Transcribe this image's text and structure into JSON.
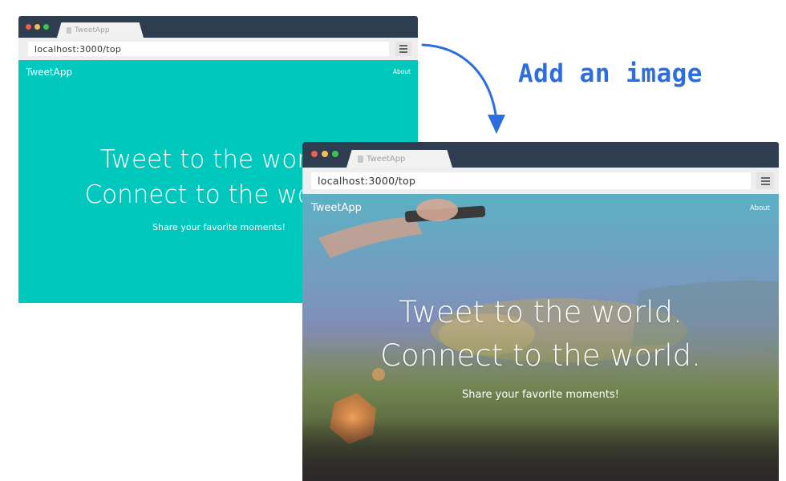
{
  "annotation": {
    "label": "Add an image",
    "color": "#2c6ee0"
  },
  "colors": {
    "titlebar": "#2f3d50",
    "teal_background": "#00c8bd",
    "traffic_red": "#f25c54",
    "traffic_yellow": "#f5bf4f",
    "traffic_green": "#3bc54d"
  },
  "before": {
    "tab_title": "TweetApp",
    "url": "localhost:3000/top",
    "tab_icon": "file-icon",
    "menu_icon": "hamburger-menu-icon",
    "nav_logo": "TweetApp",
    "nav_about": "About",
    "hero_line1": "Tweet to the world.",
    "hero_line2": "Connect to the world.",
    "sub": "Share your favorite moments!"
  },
  "after": {
    "tab_title": "TweetApp",
    "url": "localhost:3000/top",
    "tab_icon": "file-icon",
    "menu_icon": "hamburger-menu-icon",
    "nav_logo": "TweetApp",
    "nav_about": "About",
    "hero_line1": "Tweet to the world.",
    "hero_line2": "Connect to the world.",
    "sub": "Share your favorite moments!"
  }
}
